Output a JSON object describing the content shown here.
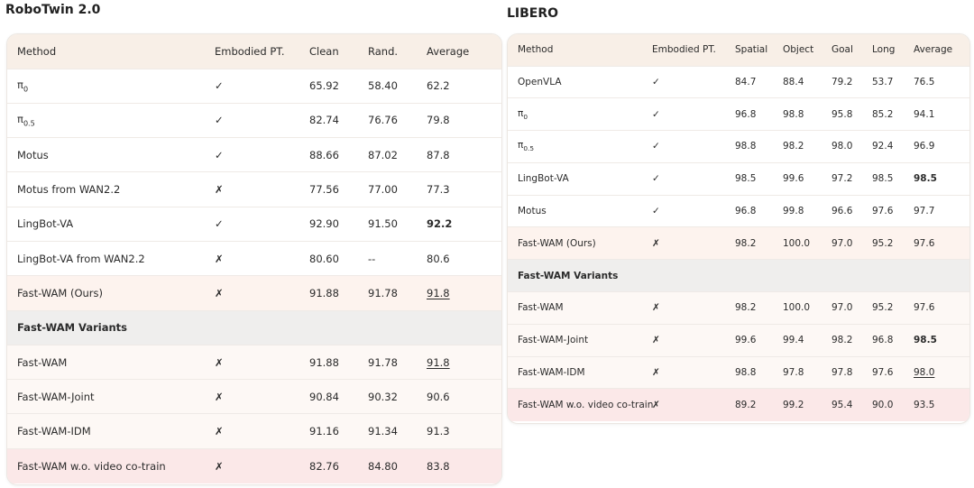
{
  "robotwin": {
    "title": "RoboTwin 2.0",
    "headers": [
      "Method",
      "Embodied PT.",
      "Clean",
      "Rand.",
      "Average"
    ],
    "rows": [
      {
        "method": "π",
        "sub": "0",
        "pt": "✓",
        "clean": "65.92",
        "rand": "58.40",
        "avg": "62.2"
      },
      {
        "method": "π",
        "sub": "0.5",
        "pt": "✓",
        "clean": "82.74",
        "rand": "76.76",
        "avg": "79.8"
      },
      {
        "method": "Motus",
        "pt": "✓",
        "clean": "88.66",
        "rand": "87.02",
        "avg": "87.8"
      },
      {
        "method": "Motus from WAN2.2",
        "pt": "✗",
        "clean": "77.56",
        "rand": "77.00",
        "avg": "77.3"
      },
      {
        "method": "LingBot-VA",
        "pt": "✓",
        "clean": "92.90",
        "rand": "91.50",
        "avg": "92.2",
        "avg_style": "bold"
      },
      {
        "method": "LingBot-VA from WAN2.2",
        "pt": "✗",
        "clean": "80.60",
        "rand": "--",
        "avg": "80.6"
      },
      {
        "method": "Fast-WAM (Ours)",
        "pt": "✗",
        "clean": "91.88",
        "rand": "91.78",
        "avg": "91.8",
        "avg_style": "underline",
        "row_style": "ours"
      }
    ],
    "variants_label": "Fast-WAM Variants",
    "variants": [
      {
        "method": "Fast-WAM",
        "pt": "✗",
        "clean": "91.88",
        "rand": "91.78",
        "avg": "91.8",
        "avg_style": "underline"
      },
      {
        "method": "Fast-WAM-Joint",
        "pt": "✗",
        "clean": "90.84",
        "rand": "90.32",
        "avg": "90.6"
      },
      {
        "method": "Fast-WAM-IDM",
        "pt": "✗",
        "clean": "91.16",
        "rand": "91.34",
        "avg": "91.3"
      },
      {
        "method": "Fast-WAM w.o. video co-train",
        "pt": "✗",
        "clean": "82.76",
        "rand": "84.80",
        "avg": "83.8",
        "row_style": "cotrain"
      }
    ]
  },
  "libero": {
    "title": "LIBERO",
    "headers": [
      "Method",
      "Embodied PT.",
      "Spatial",
      "Object",
      "Goal",
      "Long",
      "Average"
    ],
    "rows": [
      {
        "method": "OpenVLA",
        "pt": "✓",
        "spatial": "84.7",
        "object": "88.4",
        "goal": "79.2",
        "long": "53.7",
        "avg": "76.5"
      },
      {
        "method": "π",
        "sub": "0",
        "pt": "✓",
        "spatial": "96.8",
        "object": "98.8",
        "goal": "95.8",
        "long": "85.2",
        "avg": "94.1"
      },
      {
        "method": "π",
        "sub": "0.5",
        "pt": "✓",
        "spatial": "98.8",
        "object": "98.2",
        "goal": "98.0",
        "long": "92.4",
        "avg": "96.9"
      },
      {
        "method": "LingBot-VA",
        "pt": "✓",
        "spatial": "98.5",
        "object": "99.6",
        "goal": "97.2",
        "long": "98.5",
        "avg": "98.5",
        "avg_style": "bold"
      },
      {
        "method": "Motus",
        "pt": "✓",
        "spatial": "96.8",
        "object": "99.8",
        "goal": "96.6",
        "long": "97.6",
        "avg": "97.7"
      },
      {
        "method": "Fast-WAM (Ours)",
        "pt": "✗",
        "spatial": "98.2",
        "object": "100.0",
        "goal": "97.0",
        "long": "95.2",
        "avg": "97.6",
        "row_style": "ours"
      }
    ],
    "variants_label": "Fast-WAM Variants",
    "variants": [
      {
        "method": "Fast-WAM",
        "pt": "✗",
        "spatial": "98.2",
        "object": "100.0",
        "goal": "97.0",
        "long": "95.2",
        "avg": "97.6"
      },
      {
        "method": "Fast-WAM-Joint",
        "pt": "✗",
        "spatial": "99.6",
        "object": "99.4",
        "goal": "98.2",
        "long": "96.8",
        "avg": "98.5",
        "avg_style": "bold"
      },
      {
        "method": "Fast-WAM-IDM",
        "pt": "✗",
        "spatial": "98.8",
        "object": "97.8",
        "goal": "97.8",
        "long": "97.6",
        "avg": "98.0",
        "avg_style": "underline"
      },
      {
        "method": "Fast-WAM w.o. video co-train",
        "pt": "✗",
        "spatial": "89.2",
        "object": "99.2",
        "goal": "95.4",
        "long": "90.0",
        "avg": "93.5",
        "row_style": "cotrain"
      }
    ]
  }
}
